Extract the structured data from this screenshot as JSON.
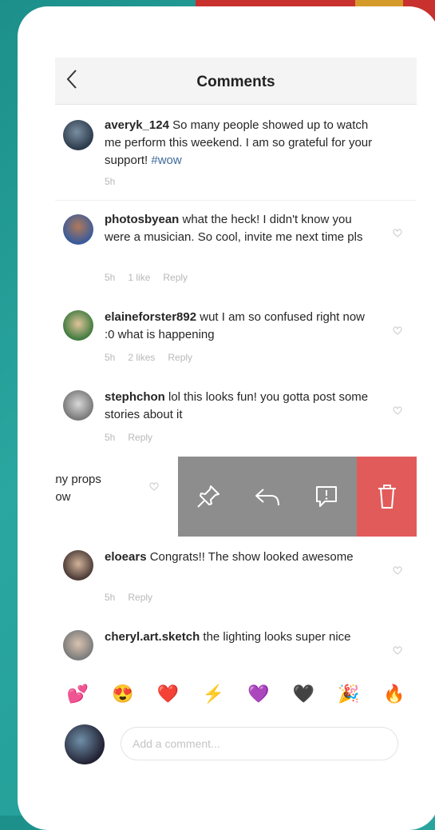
{
  "header": {
    "back_icon": "chevron-left-icon",
    "title": "Comments"
  },
  "comments": [
    {
      "username": "averyk_124",
      "text": " So many people showed up to watch me perform this weekend. I am so grateful for your support! ",
      "hashtag": "#wow",
      "time": "5h"
    },
    {
      "username": "photosbyean",
      "text": " what the heck! I didn't know you were a musician. So cool, invite me next time pls",
      "time": "5h",
      "likes": "1 like",
      "reply": "Reply"
    },
    {
      "username": "elaineforster892",
      "text": " wut I am so confused right now :0 what is happening",
      "time": "5h",
      "likes": "2 likes",
      "reply": "Reply"
    },
    {
      "username": "stephchon",
      "text": " lol this looks fun! you gotta post some stories about it",
      "time": "5h",
      "reply": "Reply"
    },
    {
      "username": "eloears",
      "text": " Congrats!! The show looked awesome",
      "time": "5h",
      "reply": "Reply"
    },
    {
      "username": "cheryl.art.sketch",
      "text": " the lighting looks super nice"
    }
  ],
  "swiped_comment": {
    "line1": "any props",
    "line2": "how"
  },
  "swipe_actions": [
    "pin-icon",
    "reply-icon",
    "report-icon",
    "trash-icon"
  ],
  "colors": {
    "action_gray": "#8d8d8d",
    "delete_red": "#e25b5b",
    "hashtag": "#3d6a9a"
  },
  "emojis": [
    "💕",
    "😍",
    "❤️",
    "⚡",
    "💜",
    "🖤",
    "🎉",
    "🔥"
  ],
  "composer": {
    "placeholder": "Add a comment..."
  }
}
